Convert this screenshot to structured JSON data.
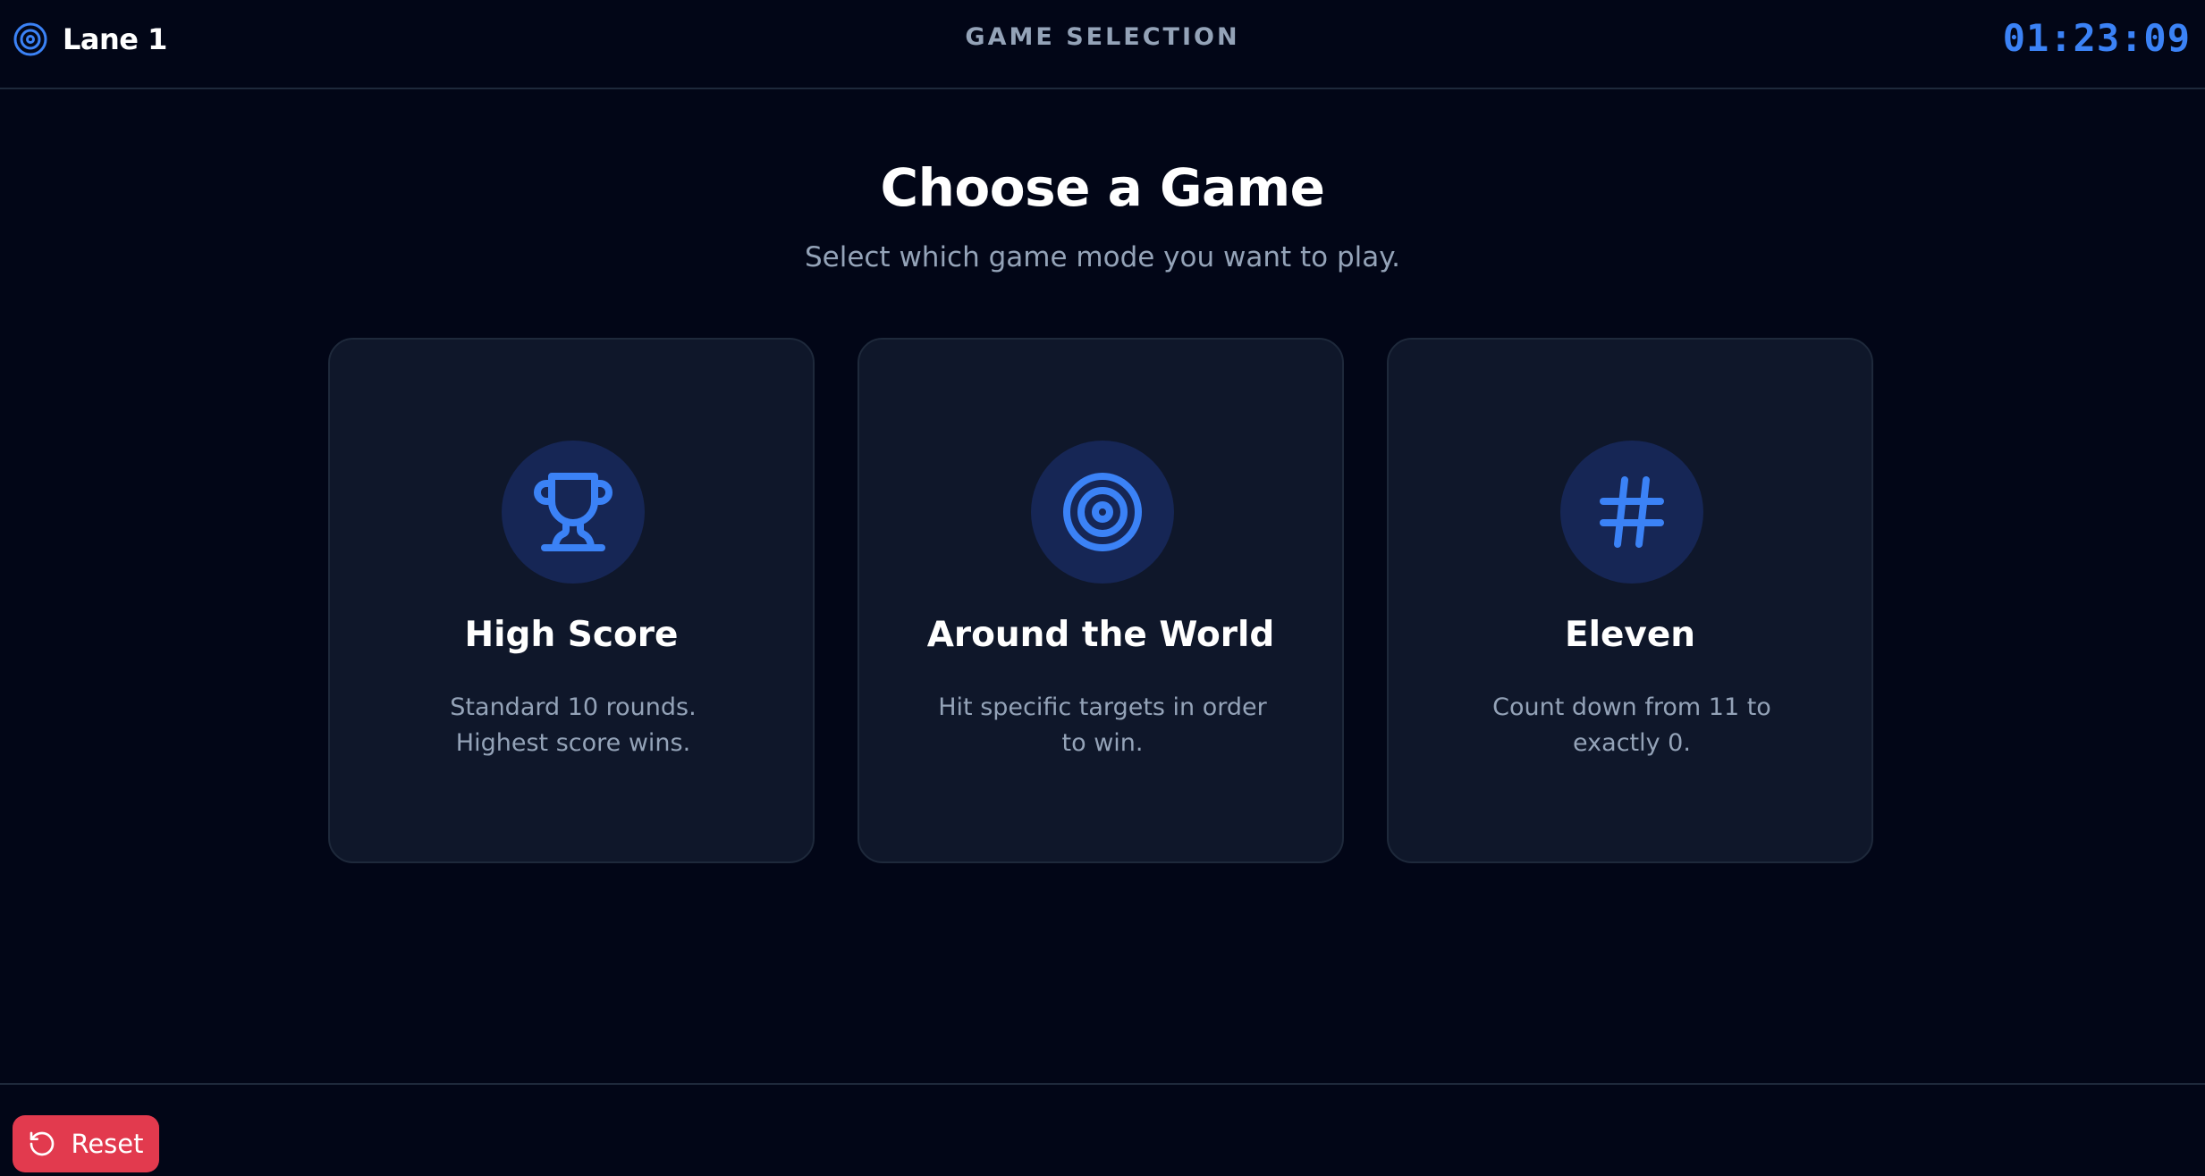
{
  "header": {
    "lane_name": "Lane 1",
    "lane_icon": "target-icon",
    "screen_title": "GAME SELECTION",
    "clock": "01:23:09"
  },
  "main": {
    "title": "Choose a Game",
    "subtitle": "Select which game mode you want to play."
  },
  "games": [
    {
      "icon": "trophy-icon",
      "title": "High Score",
      "description": "Standard 10 rounds. Highest score wins."
    },
    {
      "icon": "target-icon",
      "title": "Around the World",
      "description": "Hit specific targets in order to win."
    },
    {
      "icon": "hash-icon",
      "title": "Eleven",
      "description": "Count down from 11 to exactly 0."
    }
  ],
  "footer": {
    "reset_label": "Reset",
    "reset_icon": "rotate-ccw-icon"
  },
  "colors": {
    "background": "#020617",
    "card": "#0f172a",
    "accent": "#3b82f6",
    "muted_text": "#94a3b8",
    "danger": "#e23a4e"
  }
}
